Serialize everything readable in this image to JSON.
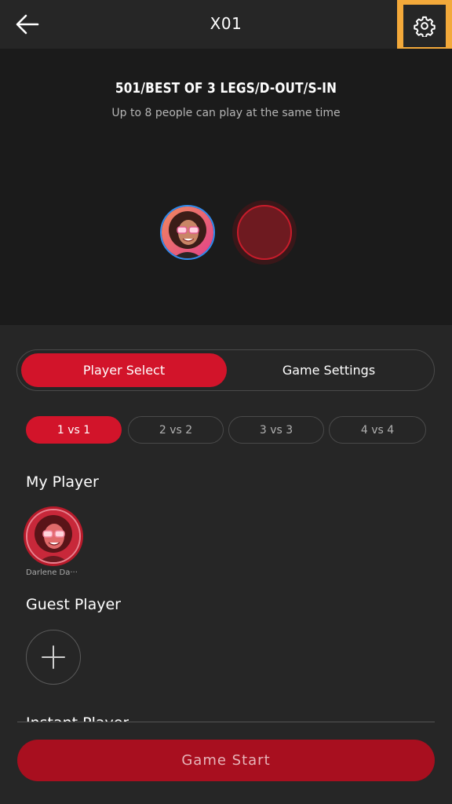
{
  "header": {
    "title": "X01",
    "back_icon": "arrow-left-icon",
    "settings_icon": "gear-icon",
    "highlight_color": "#f3a93a"
  },
  "preview": {
    "game_title": "501/BEST OF 3 LEGS/D-OUT/S-IN",
    "subtitle": "Up to 8 people can play at the same time"
  },
  "tabs": [
    {
      "label": "Player Select",
      "active": true
    },
    {
      "label": "Game Settings",
      "active": false
    }
  ],
  "modes": [
    {
      "label": "1 vs 1",
      "active": true
    },
    {
      "label": "2 vs 2",
      "active": false
    },
    {
      "label": "3 vs 3",
      "active": false
    },
    {
      "label": "4 vs 4",
      "active": false
    }
  ],
  "my_player": {
    "section_label": "My Player",
    "name": "Darlene Da···"
  },
  "guest_player": {
    "section_label": "Guest Player",
    "add_icon": "plus-icon"
  },
  "instant_player": {
    "section_label": "Instant Player"
  },
  "start_button": {
    "label": "Game Start"
  },
  "colors": {
    "accent": "#d2142a",
    "start_button": "#a80f1f",
    "background": "#262626",
    "preview_bg": "#1b1b1b",
    "player_ring": "#2e8cf0"
  }
}
